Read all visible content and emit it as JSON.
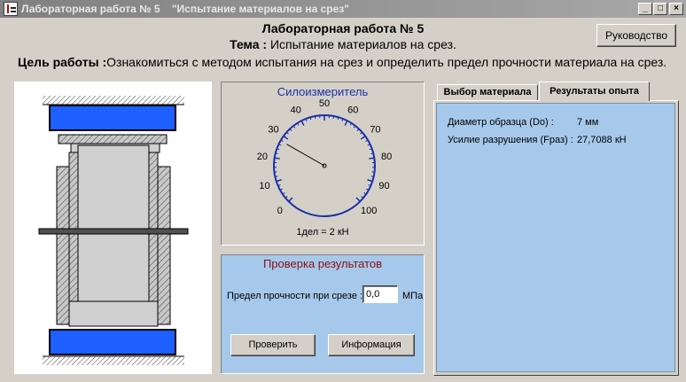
{
  "window": {
    "title": "Лабораторная работа № 5    \"Испытание материалов на срез\"",
    "minimize_label": "_",
    "maximize_label": "□",
    "close_label": "×"
  },
  "header": {
    "title": "Лабораторная работа № 5",
    "theme_prefix": "Тема :",
    "theme_text": " Испытание материалов на срез.",
    "goal_prefix": "Цель работы :",
    "goal_text": "Ознакомиться с методом испытания на срез и определить предел прочности материала на срез.",
    "guide_button": "Руководство"
  },
  "gauge": {
    "title": "Силоизмеритель",
    "scale_labels": [
      "0",
      "10",
      "20",
      "30",
      "40",
      "50",
      "60",
      "70",
      "80",
      "90",
      "100"
    ],
    "division_note": "1дел = 2 кН",
    "reading": 27.7,
    "needle_value": 27.7088,
    "accent_color": "#1a2fa8"
  },
  "check": {
    "title": "Проверка результатов",
    "label": "Предел прочности при срезе :",
    "input_value": "0,0",
    "unit": "МПа",
    "check_button": "Проверить",
    "info_button": "Информация"
  },
  "tabs": {
    "material_label": "Выбор материала",
    "results_label": "Результаты опыта"
  },
  "results": {
    "diameter_label": "Диаметр образца (Dо) :",
    "diameter_value": "7 мм",
    "force_label": "Усилие разрушения (Fраз) :",
    "force_value": "27,7088 кН"
  },
  "colors": {
    "panel_blue": "#a6c8ea",
    "press_blue": "#1e5fff",
    "title_red": "#8b1010"
  }
}
